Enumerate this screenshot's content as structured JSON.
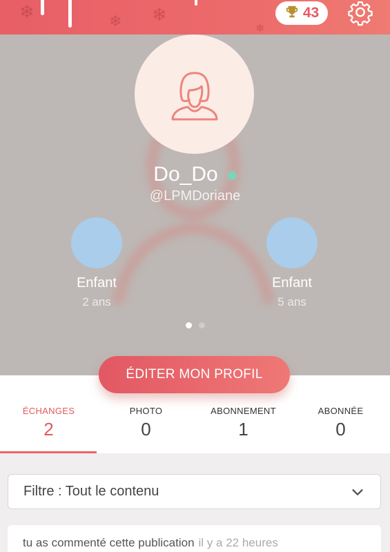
{
  "header": {
    "trophy_count": "43",
    "trophy_icon": "trophy-icon",
    "settings_icon": "gear-icon",
    "background_color": "#e85f66"
  },
  "profile": {
    "username": "Do_Do",
    "handle": "@LPMDoriane",
    "online_status_color": "#7fd3b6",
    "avatar_icon": "user-silhouette-icon",
    "children": [
      {
        "label": "Enfant",
        "age": "2 ans"
      },
      {
        "label": "Enfant",
        "age": "5 ans"
      }
    ],
    "carousel": {
      "pages": 2,
      "active_page": 1
    }
  },
  "edit_button": {
    "label": "ÉDITER MON PROFIL"
  },
  "stats": [
    {
      "label": "ÉCHANGES",
      "value": "2",
      "active": true
    },
    {
      "label": "PHOTO",
      "value": "0",
      "active": false
    },
    {
      "label": "ABONNEMENT",
      "value": "1",
      "active": false
    },
    {
      "label": "ABONNÉE",
      "value": "0",
      "active": false
    }
  ],
  "filter": {
    "label": "Filtre : Tout le contenu",
    "icon": "chevron-down-icon"
  },
  "activity": [
    {
      "text": "tu as commenté cette publication",
      "time": "il y a 22 heures"
    }
  ],
  "colors": {
    "accent": "#e85a62",
    "hero_background": "#bdb8b5",
    "child_avatar": "#a9cdea"
  }
}
